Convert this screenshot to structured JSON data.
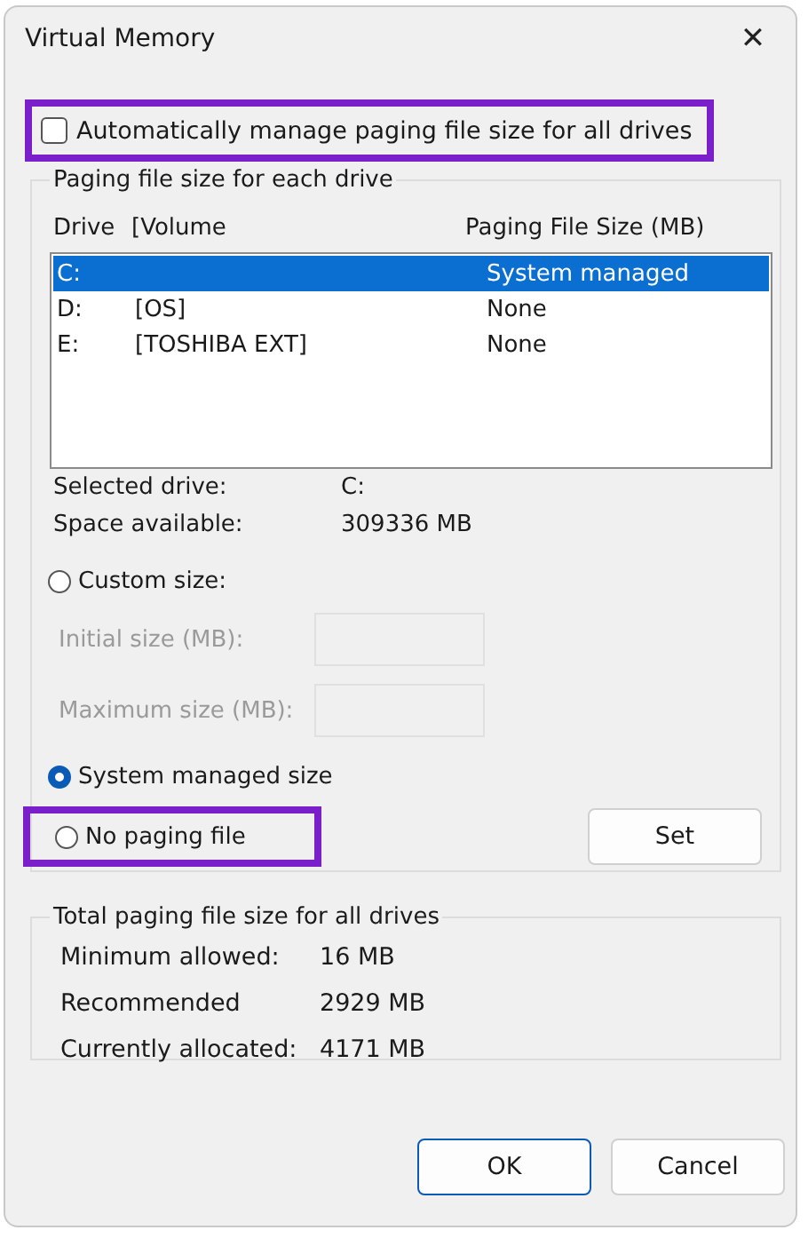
{
  "window": {
    "title": "Virtual Memory",
    "close": "✕"
  },
  "auto_manage": {
    "label": "Automatically manage paging file size for all drives",
    "checked": false,
    "highlighted": true
  },
  "drives_group": {
    "title": "Paging file size for each drive",
    "columns": [
      "Drive",
      "[Volume",
      "Paging File Size (MB)"
    ],
    "rows": [
      {
        "drive": "C:",
        "volume": "",
        "size": "System managed",
        "selected": true
      },
      {
        "drive": "D:",
        "volume": "[OS]",
        "size": "None",
        "selected": false
      },
      {
        "drive": "E:",
        "volume": "[TOSHIBA EXT]",
        "size": "None",
        "selected": false
      }
    ],
    "info": [
      {
        "label": "Selected drive:",
        "value": "C:"
      },
      {
        "label": "Space available:",
        "value": "309336 MB"
      }
    ],
    "options": [
      {
        "label": "Custom size:",
        "selected": false,
        "highlighted": false
      },
      {
        "label": "System managed size",
        "selected": true,
        "highlighted": false
      },
      {
        "label": "No paging file",
        "selected": false,
        "highlighted": true
      }
    ],
    "fields": [
      {
        "label": "Initial size (MB):",
        "disabled": true
      },
      {
        "label": "Maximum size (MB):",
        "disabled": true
      }
    ],
    "set_button": "Set"
  },
  "totals_group": {
    "title": "Total paging file size for all drives",
    "rows": [
      {
        "label": "Minimum allowed:",
        "value": "16 MB"
      },
      {
        "label": "Recommended",
        "value": "2929 MB"
      },
      {
        "label": "Currently allocated:",
        "value": "4171 MB"
      }
    ]
  },
  "buttons": [
    {
      "label": "OK",
      "default": true
    },
    {
      "label": "Cancel",
      "default": false
    }
  ]
}
